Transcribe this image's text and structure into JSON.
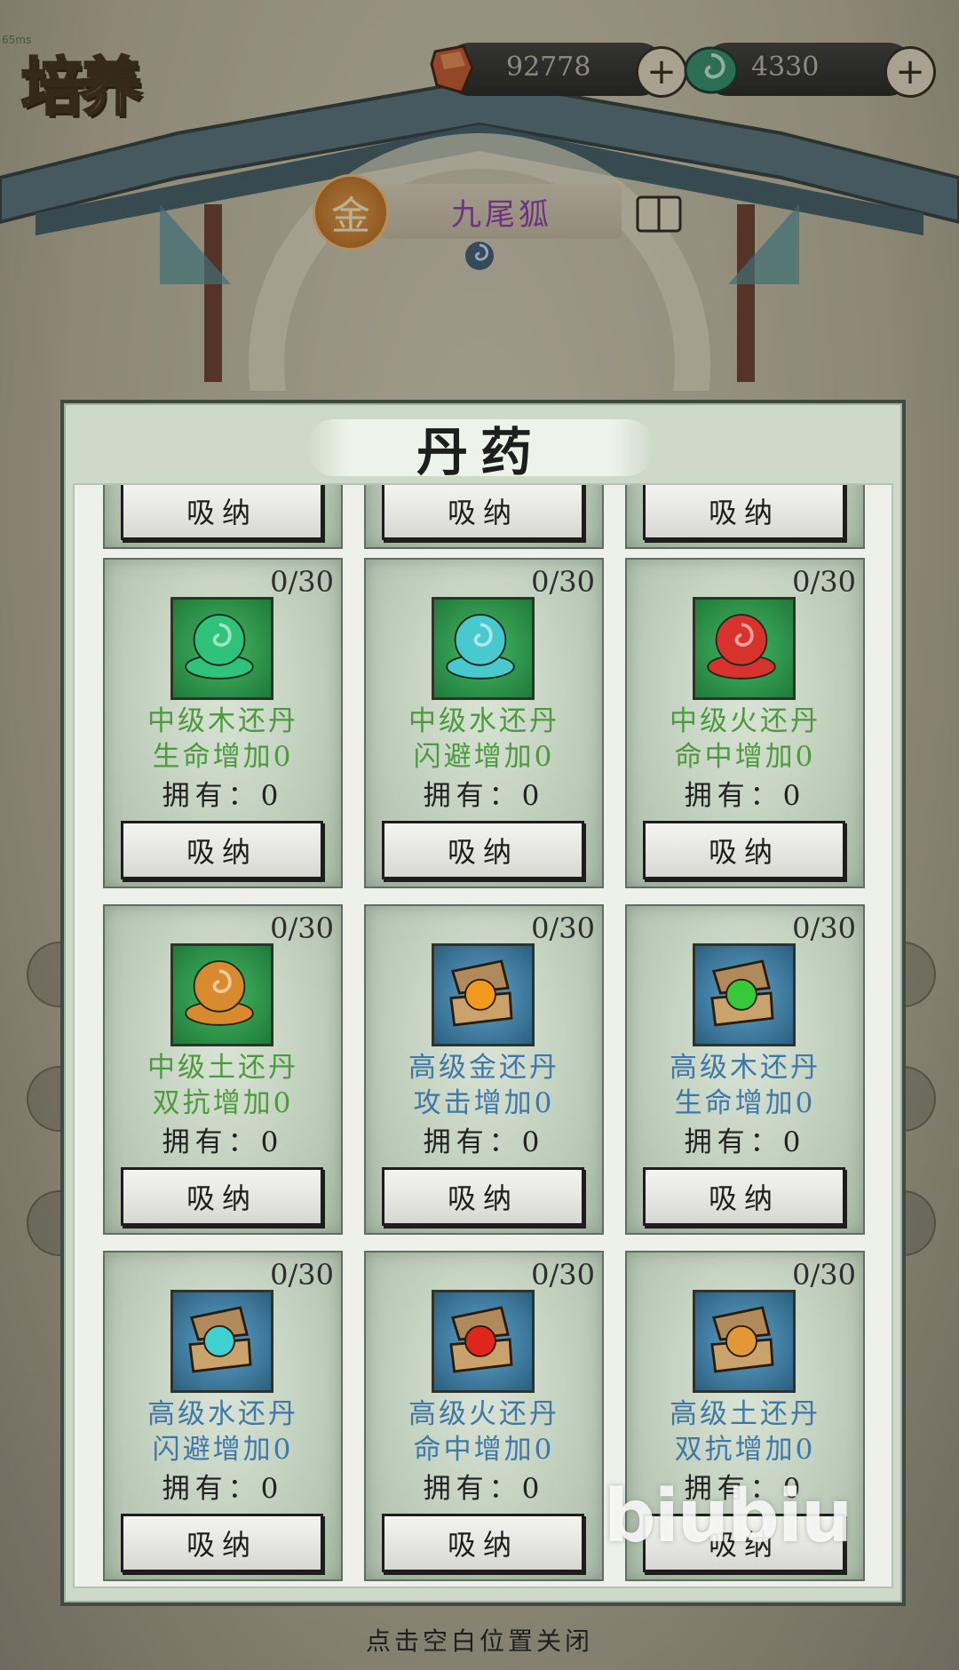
{
  "header": {
    "title": "培养",
    "fps_text": "65ms",
    "ore_value": "92778",
    "jade_value": "4330",
    "plus_symbol": "+"
  },
  "pet": {
    "element_glyph": "金",
    "name": "九尾狐"
  },
  "modal": {
    "title": "丹药",
    "absorb_label": "吸纳",
    "top_row": [
      {
        "button": "吸纳"
      },
      {
        "button": "吸纳"
      },
      {
        "button": "吸纳"
      }
    ],
    "items": [
      {
        "count": "0/30",
        "name": "中级木还丹",
        "effect": "生命增加0",
        "owned": "拥有：0",
        "button": "吸纳",
        "tier": "mid",
        "orb_color": "#2fc27a",
        "bg_color": "#3aa556",
        "text_color": "green"
      },
      {
        "count": "0/30",
        "name": "中级水还丹",
        "effect": "闪避增加0",
        "owned": "拥有：0",
        "button": "吸纳",
        "tier": "mid",
        "orb_color": "#48c9cf",
        "bg_color": "#3aa556",
        "text_color": "green"
      },
      {
        "count": "0/30",
        "name": "中级火还丹",
        "effect": "命中增加0",
        "owned": "拥有：0",
        "button": "吸纳",
        "tier": "mid",
        "orb_color": "#d8322d",
        "bg_color": "#3aa556",
        "text_color": "green"
      },
      {
        "count": "0/30",
        "name": "中级土还丹",
        "effect": "双抗增加0",
        "owned": "拥有：0",
        "button": "吸纳",
        "tier": "mid",
        "orb_color": "#d98a2e",
        "bg_color": "#3aa556",
        "text_color": "green"
      },
      {
        "count": "0/30",
        "name": "高级金还丹",
        "effect": "攻击增加0",
        "owned": "拥有：0",
        "button": "吸纳",
        "tier": "high",
        "orb_color": "#f29a1e",
        "bg_color": "#4f8fb4",
        "text_color": "blue"
      },
      {
        "count": "0/30",
        "name": "高级木还丹",
        "effect": "生命增加0",
        "owned": "拥有：0",
        "button": "吸纳",
        "tier": "high",
        "orb_color": "#36c93a",
        "bg_color": "#4f8fb4",
        "text_color": "blue"
      },
      {
        "count": "0/30",
        "name": "高级水还丹",
        "effect": "闪避增加0",
        "owned": "拥有：0",
        "button": "吸纳",
        "tier": "high",
        "orb_color": "#3fd0d2",
        "bg_color": "#4f8fb4",
        "text_color": "blue"
      },
      {
        "count": "0/30",
        "name": "高级火还丹",
        "effect": "命中增加0",
        "owned": "拥有：0",
        "button": "吸纳",
        "tier": "high",
        "orb_color": "#e0251c",
        "bg_color": "#4f8fb4",
        "text_color": "blue"
      },
      {
        "count": "0/30",
        "name": "高级土还丹",
        "effect": "双抗增加0",
        "owned": "拥有：0",
        "button": "吸纳",
        "tier": "high",
        "orb_color": "#e39838",
        "bg_color": "#4f8fb4",
        "text_color": "blue"
      }
    ]
  },
  "watermark": "biubiu",
  "close_hint": "点击空白位置关闭"
}
